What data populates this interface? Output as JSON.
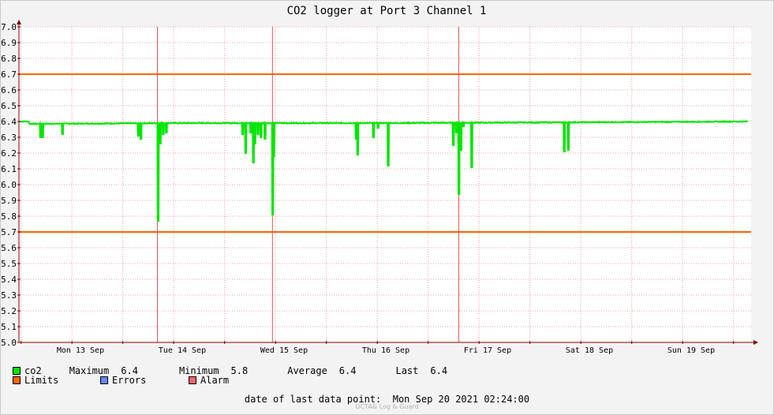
{
  "chart_data": {
    "type": "line",
    "title": "CO2 logger at Port 3 Channel 1",
    "ylim": [
      5.0,
      7.0
    ],
    "y_ticks": [
      "5.0",
      "5.1",
      "5.2",
      "5.3",
      "5.4",
      "5.5",
      "5.6",
      "5.7",
      "5.8",
      "5.9",
      "6.0",
      "6.1",
      "6.2",
      "6.3",
      "6.4",
      "6.5",
      "6.6",
      "6.7",
      "6.8",
      "6.9",
      "7.0"
    ],
    "x_labels": [
      "Mon 13 Sep",
      "Tue 14 Sep",
      "Wed 15 Sep",
      "Thu 16 Sep",
      "Fri 17 Sep",
      "Sat 18 Sep",
      "Sun 19 Sep"
    ],
    "x_range_days": [
      0,
      7.06
    ],
    "limits": {
      "upper": 6.7,
      "lower": 5.7
    },
    "alarm_markers_days": [
      1.26,
      2.39,
      4.22
    ],
    "series": [
      {
        "name": "co2",
        "baseline": [
          [
            0,
            6.385
          ],
          [
            1.5,
            6.39
          ],
          [
            3.5,
            6.39
          ],
          [
            5.5,
            6.395
          ],
          [
            7.06,
            6.4
          ]
        ],
        "dips": [
          {
            "day": 0.105,
            "value": 6.3
          },
          {
            "day": 0.125,
            "value": 6.3
          },
          {
            "day": 0.32,
            "value": 6.32
          },
          {
            "day": 1.065,
            "value": 6.31
          },
          {
            "day": 1.09,
            "value": 6.29
          },
          {
            "day": 1.26,
            "value": 5.77
          },
          {
            "day": 1.28,
            "value": 6.26
          },
          {
            "day": 1.31,
            "value": 6.32
          },
          {
            "day": 1.34,
            "value": 6.33
          },
          {
            "day": 2.09,
            "value": 6.32
          },
          {
            "day": 2.12,
            "value": 6.2
          },
          {
            "day": 2.17,
            "value": 6.33
          },
          {
            "day": 2.195,
            "value": 6.14
          },
          {
            "day": 2.21,
            "value": 6.26
          },
          {
            "day": 2.24,
            "value": 6.32
          },
          {
            "day": 2.27,
            "value": 6.3
          },
          {
            "day": 2.31,
            "value": 6.29
          },
          {
            "day": 2.385,
            "value": 5.81
          },
          {
            "day": 2.395,
            "value": 6.18
          },
          {
            "day": 3.205,
            "value": 6.29
          },
          {
            "day": 3.22,
            "value": 6.19
          },
          {
            "day": 3.375,
            "value": 6.3
          },
          {
            "day": 3.42,
            "value": 6.36
          },
          {
            "day": 3.52,
            "value": 6.12
          },
          {
            "day": 4.16,
            "value": 6.25
          },
          {
            "day": 4.19,
            "value": 6.33
          },
          {
            "day": 4.215,
            "value": 5.94
          },
          {
            "day": 4.235,
            "value": 6.22
          },
          {
            "day": 4.26,
            "value": 6.37
          },
          {
            "day": 4.34,
            "value": 6.11
          },
          {
            "day": 5.25,
            "value": 6.21
          },
          {
            "day": 5.29,
            "value": 6.22
          }
        ]
      }
    ],
    "legend": {
      "co2_label": "co2",
      "max_label": "Maximum",
      "max_value": "6.4",
      "min_label": "Minimum",
      "min_value": "5.8",
      "avg_label": "Average",
      "avg_value": "6.4",
      "last_label": "Last",
      "last_value": "6.4",
      "limits_label": "Limits",
      "errors_label": "Errors",
      "alarm_label": "Alarm"
    },
    "colors": {
      "series": "#00e600",
      "limits": "#ff6600",
      "errors": "#6688ff",
      "alarm": "#ff6666",
      "alarm_line": "#e05050",
      "grid": "#e8a0a0",
      "axis": "#800000"
    }
  },
  "footer": {
    "label": "date of last data point:",
    "value": "Mon Sep 20 2021 02:24:00",
    "watermark": "OCTA& Log & Guard"
  }
}
